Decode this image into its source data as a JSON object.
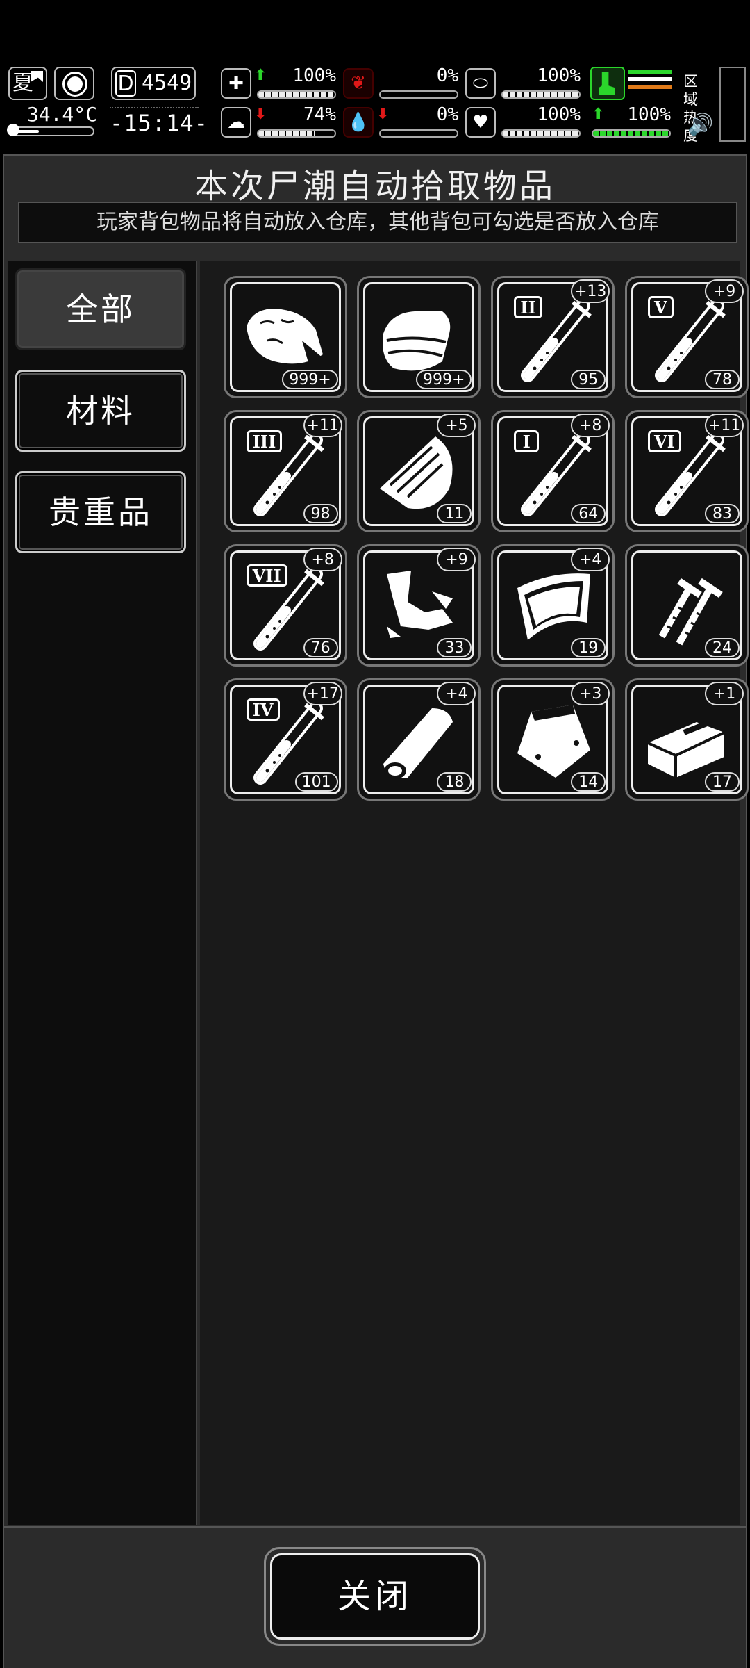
{
  "hud": {
    "season": "夏",
    "temperature": "34.4°C",
    "day_letter": "D",
    "day_number": "4549",
    "clock": "-15:14-",
    "stats": {
      "health": {
        "value": "100%",
        "trend": "up",
        "icon": "medkit-icon"
      },
      "hunger": {
        "value": "0%",
        "trend": "none",
        "icon": "stomach-icon"
      },
      "pill": {
        "value": "100%",
        "trend": "none",
        "icon": "pill-icon"
      },
      "sanity": {
        "value": "74%",
        "trend": "down",
        "icon": "brain-icon"
      },
      "blood": {
        "value": "0%",
        "trend": "down",
        "icon": "blood-drop-icon"
      },
      "heart": {
        "value": "100%",
        "trend": "none",
        "icon": "heart-icon"
      },
      "stamina": {
        "value": "100%",
        "trend": "up",
        "icon": "boot-icon"
      }
    },
    "zone_label_1": "区域",
    "zone_label_2": "热度",
    "colors": {
      "up": "#2bd62b",
      "down": "#e01818",
      "stripe1": "#2bd62b",
      "stripe2": "#ffffff",
      "stripe3": "#e07a18"
    }
  },
  "panel": {
    "title": "本次尸潮自动拾取物品",
    "subtitle": "玩家背包物品将自动放入仓库，其他背包可勾选是否放入仓库"
  },
  "tabs": [
    {
      "label": "全部",
      "active": true
    },
    {
      "label": "材料",
      "active": false
    },
    {
      "label": "贵重品",
      "active": false
    }
  ],
  "items": [
    {
      "name": "raw-meat-icon",
      "count": "999+",
      "bonus": ""
    },
    {
      "name": "cloth-icon",
      "count": "999+",
      "bonus": ""
    },
    {
      "name": "test-tube-icon",
      "tube": "II",
      "count": "95",
      "bonus": "+13"
    },
    {
      "name": "test-tube-icon",
      "tube": "V",
      "count": "78",
      "bonus": "+9"
    },
    {
      "name": "test-tube-icon",
      "tube": "III",
      "count": "98",
      "bonus": "+11"
    },
    {
      "name": "wood-plank-icon",
      "count": "11",
      "bonus": "+5"
    },
    {
      "name": "test-tube-icon",
      "tube": "I",
      "count": "64",
      "bonus": "+8"
    },
    {
      "name": "test-tube-icon",
      "tube": "VI",
      "count": "83",
      "bonus": "+11"
    },
    {
      "name": "test-tube-icon",
      "tube": "VII",
      "count": "76",
      "bonus": "+8"
    },
    {
      "name": "scrap-metal-icon",
      "count": "33",
      "bonus": "+9"
    },
    {
      "name": "curved-plate-icon",
      "count": "19",
      "bonus": "+4"
    },
    {
      "name": "nails-icon",
      "count": "24",
      "bonus": ""
    },
    {
      "name": "test-tube-icon",
      "tube": "IV",
      "count": "101",
      "bonus": "+17"
    },
    {
      "name": "rolled-cloth-icon",
      "count": "18",
      "bonus": "+4"
    },
    {
      "name": "plastic-bag-icon",
      "count": "14",
      "bonus": "+3"
    },
    {
      "name": "box-icon",
      "count": "17",
      "bonus": "+1"
    }
  ],
  "fills": {
    "health": 1.0,
    "hunger": 0.0,
    "pill": 1.0,
    "sanity": 0.74,
    "blood": 0.0,
    "heart": 1.0,
    "stamina": 1.0,
    "temperature": 0.3
  },
  "close_label": "关闭"
}
